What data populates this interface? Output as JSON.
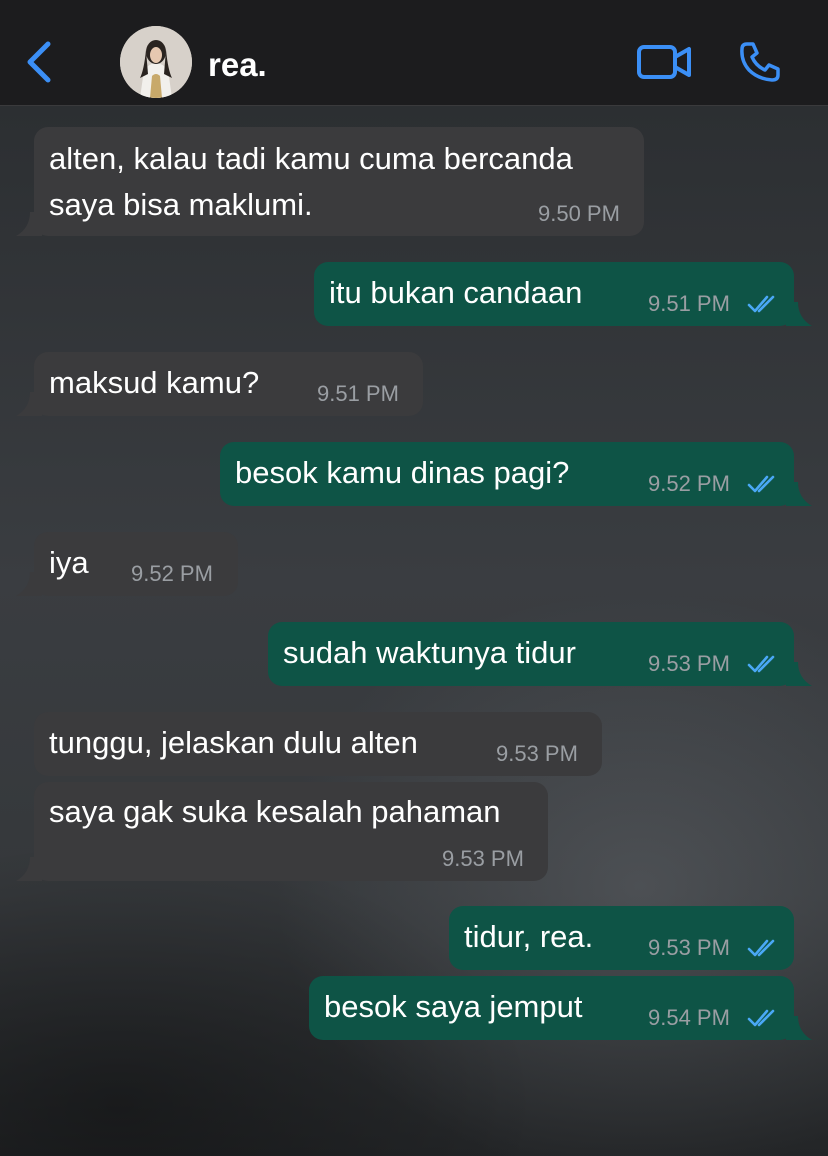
{
  "header": {
    "contact_name": "rea.",
    "back_icon": "chevron-left-icon",
    "video_icon": "video-camera-icon",
    "call_icon": "phone-icon",
    "accent_color": "#3b8ff6"
  },
  "colors": {
    "incoming_bubble": "#3b3b3d",
    "outgoing_bubble": "#0e5446",
    "read_ticks": "#4aa8f5"
  },
  "messages": [
    {
      "direction": "incoming",
      "lines": [
        "alten, kalau tadi kamu cuma bercanda",
        "saya bisa maklumi."
      ],
      "time": "9.50 PM"
    },
    {
      "direction": "outgoing",
      "lines": [
        "itu bukan candaan"
      ],
      "time": "9.51 PM",
      "status": "read"
    },
    {
      "direction": "incoming",
      "lines": [
        "maksud kamu?"
      ],
      "time": "9.51 PM"
    },
    {
      "direction": "outgoing",
      "lines": [
        "besok kamu dinas pagi?"
      ],
      "time": "9.52 PM",
      "status": "read"
    },
    {
      "direction": "incoming",
      "lines": [
        "iya"
      ],
      "time": "9.52 PM"
    },
    {
      "direction": "outgoing",
      "lines": [
        "sudah waktunya tidur"
      ],
      "time": "9.53 PM",
      "status": "read"
    },
    {
      "direction": "incoming",
      "lines": [
        "tunggu, jelaskan dulu alten"
      ],
      "time": "9.53 PM"
    },
    {
      "direction": "incoming",
      "lines": [
        "saya gak suka kesalah pahaman"
      ],
      "time": "9.53 PM"
    },
    {
      "direction": "outgoing",
      "lines": [
        "tidur, rea."
      ],
      "time": "9.53 PM",
      "status": "read"
    },
    {
      "direction": "outgoing",
      "lines": [
        "besok saya jemput"
      ],
      "time": "9.54 PM",
      "status": "read"
    }
  ]
}
